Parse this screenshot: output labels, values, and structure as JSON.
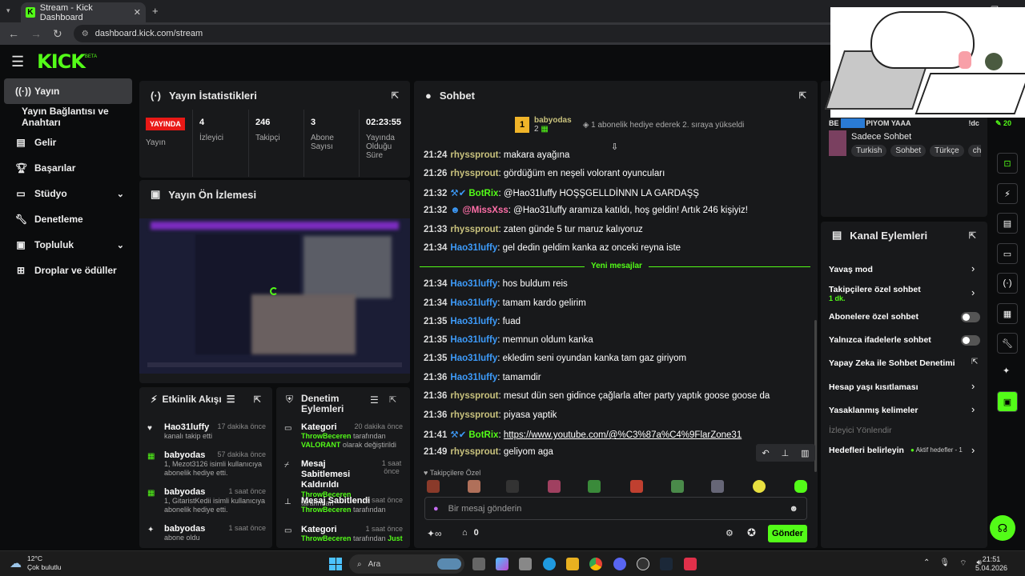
{
  "browser": {
    "tab_title": "Stream - Kick Dashboard",
    "url": "dashboard.kick.com/stream"
  },
  "colors": {
    "accent": "#53fc18",
    "live": "#e91916",
    "panel": "#18191b"
  },
  "topbar": {
    "logo": "KICK",
    "beta": "BETA"
  },
  "sidebar": {
    "items": [
      {
        "label": "Yayın",
        "icon": "broadcast-icon"
      },
      {
        "label": "Yayın Bağlantısı ve Anahtarı",
        "icon": ""
      },
      {
        "label": "Gelir",
        "icon": "wallet-icon"
      },
      {
        "label": "Başarılar",
        "icon": "trophy-icon"
      },
      {
        "label": "Stüdyo",
        "icon": "studio-icon"
      },
      {
        "label": "Denetleme",
        "icon": "wrench-icon"
      },
      {
        "label": "Topluluk",
        "icon": "community-icon"
      },
      {
        "label": "Droplar ve ödüller",
        "icon": "gift-icon"
      }
    ]
  },
  "stats": {
    "title": "Yayın İstatistikleri",
    "live_badge": "YAYINDA",
    "live_label": "Yayın",
    "items": [
      {
        "value": "4",
        "label": "İzleyici"
      },
      {
        "value": "246",
        "label": "Takipçi"
      },
      {
        "value": "3",
        "label": "Abone Sayısı"
      },
      {
        "value": "02:23:55",
        "label": "Yayında Olduğu Süre"
      }
    ]
  },
  "preview": {
    "title": "Yayın Ön İzlemesi"
  },
  "events": {
    "title": "Etkinlik Akışı",
    "items": [
      {
        "name": "Hao31luffy",
        "time": "17 dakika önce",
        "line1": "kanalı takip etti",
        "line2": "",
        "icon": "heart-icon"
      },
      {
        "name": "babyodas",
        "time": "57 dakika önce",
        "line1": "1, Mezot3126 isimli kullanıcıya",
        "line2": "abonelik hediye etti.",
        "icon": "gift-icon"
      },
      {
        "name": "babyodas",
        "time": "1 saat önce",
        "line1": "1, GitaristKedii isimli kullanıcıya",
        "line2": "abonelik hediye etti.",
        "icon": "gift-icon"
      },
      {
        "name": "babyodas",
        "time": "1 saat önce",
        "line1": "abone oldu",
        "line2": "",
        "icon": "star-icon"
      }
    ]
  },
  "moderation": {
    "title_l1": "Denetim",
    "title_l2": "Eylemleri",
    "items": [
      {
        "name": "Kategori",
        "time": "20 dakika önce",
        "by": "ThrowBeceren",
        "by_suffix": "tarafından",
        "detail": "VALORANT",
        "detail_suffix": "olarak değiştirildi"
      },
      {
        "name": "Mesaj Sabitlemesi Kaldırıldı",
        "time": "1 saat önce",
        "by": "ThrowBeceren",
        "by_suffix": "tarafından",
        "detail": "",
        "detail_suffix": ""
      },
      {
        "name": "Mesaj Sabitlendi",
        "time": "1 saat önce",
        "by": "ThrowBeceren",
        "by_suffix": "tarafından",
        "detail": "",
        "detail_suffix": ""
      },
      {
        "name": "Kategori",
        "time": "1 saat önce",
        "by": "ThrowBeceren",
        "by_suffix": "tarafından",
        "detail": "Just",
        "detail_suffix": ""
      }
    ]
  },
  "chat": {
    "title": "Sohbet",
    "pinned": {
      "user": "babyodas",
      "count": "2",
      "note": "1 abonelik hediye ederek 2. sıraya yükseldi"
    },
    "divider": "Yeni mesajlar",
    "messages": [
      {
        "time": "21:24",
        "user": "rhyssprout",
        "color": "olive",
        "text": "makara ayağına"
      },
      {
        "time": "21:26",
        "user": "rhyssprout",
        "color": "olive",
        "text": "gördüğüm en neşeli volorant oyuncuları"
      },
      {
        "time": "21:32",
        "user": "BotRix",
        "color": "green",
        "text": "@Hao31luffy HOŞŞGELLDİNNN LA GARDAŞŞ"
      },
      {
        "time": "21:32",
        "user": "@MissXss",
        "color": "pink",
        "text": "@Hao31luffy aramıza katıldı, hoş geldin! Artık 246 kişiyiz!"
      },
      {
        "time": "21:33",
        "user": "rhyssprout",
        "color": "olive",
        "text": "zaten günde 5 tur maruz kalıyoruz"
      },
      {
        "time": "21:34",
        "user": "Hao31luffy",
        "color": "blue",
        "text": "gel dedin geldim kanka az onceki reyna iste"
      },
      {
        "time": "21:34",
        "user": "Hao31luffy",
        "color": "blue",
        "text": "hos buldum reis"
      },
      {
        "time": "21:34",
        "user": "Hao31luffy",
        "color": "blue",
        "text": "tamam kardo gelirim"
      },
      {
        "time": "21:35",
        "user": "Hao31luffy",
        "color": "blue",
        "text": "fuad"
      },
      {
        "time": "21:35",
        "user": "Hao31luffy",
        "color": "blue",
        "text": "memnun oldum kanka"
      },
      {
        "time": "21:35",
        "user": "Hao31luffy",
        "color": "blue",
        "text": "ekledim seni oyundan kanka tam gaz giriyom"
      },
      {
        "time": "21:36",
        "user": "Hao31luffy",
        "color": "blue",
        "text": "tamamdir"
      },
      {
        "time": "21:36",
        "user": "rhyssprout",
        "color": "olive",
        "text": "mesut dün sen gidince çağlarla after party yaptık goose goose da"
      },
      {
        "time": "21:36",
        "user": "rhyssprout",
        "color": "olive",
        "text": "piyasa yaptik"
      },
      {
        "time": "21:41",
        "user": "BotRix",
        "color": "green",
        "text": "https://www.youtube.com/@%C3%87a%C4%9FlarZone31"
      },
      {
        "time": "21:49",
        "user": "rhyssprout",
        "color": "olive",
        "text": "geliyom aga"
      }
    ],
    "emote_label": "Takipçilere Özel",
    "input_placeholder": "Bir mesaj gönderin",
    "points": "0",
    "send": "Gönder"
  },
  "channel": {
    "info_prefix": "BE",
    "info_text": "PIYOM YAAA",
    "tag_text": "!dc",
    "sub_count": "20",
    "category": "Sadece Sohbet",
    "tags": [
      "Turkish",
      "Sohbet",
      "Türkçe",
      "chi"
    ]
  },
  "actions": {
    "title": "Kanal Eylemleri",
    "items": [
      {
        "label": "Yavaş mod",
        "sub": "",
        "kind": "chevron"
      },
      {
        "label": "Takipçilere özel sohbet",
        "sub": "1 dk.",
        "kind": "chevron"
      },
      {
        "label": "Abonelere özel sohbet",
        "sub": "",
        "kind": "toggle"
      },
      {
        "label": "Yalnızca ifadelerle sohbet",
        "sub": "",
        "kind": "toggle"
      },
      {
        "label": "Yapay Zeka ile Sohbet Denetimi",
        "sub": "",
        "kind": "external"
      },
      {
        "label": "Hesap yaşı kısıtlaması",
        "sub": "",
        "kind": "chevron"
      },
      {
        "label": "Yasaklanmış kelimeler",
        "sub": "",
        "kind": "chevron"
      }
    ],
    "redirect": "İzleyici Yönlendir",
    "goals_label": "Hedefleri belirleyin",
    "goals_status": "Aktif hedefler - 1"
  },
  "taskbar": {
    "temp": "12°C",
    "weather": "Çok bulutlu",
    "search": "Ara",
    "time": "21:51",
    "date": "5.04.2026"
  }
}
